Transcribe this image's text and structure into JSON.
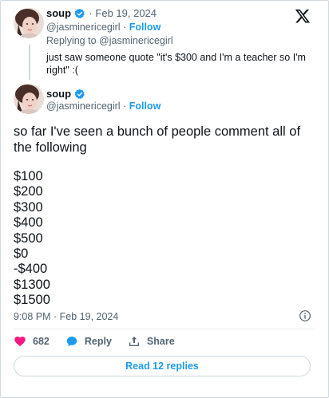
{
  "brand": {
    "logo": "x-logo-icon"
  },
  "parent_tweet": {
    "author_name": "soup",
    "verified_icon": "verified-badge-icon",
    "separator": "·",
    "date": "Feb 19, 2024",
    "handle": "@jasminericegirl",
    "follow_label": "Follow",
    "replying_to_prefix": "Replying to",
    "replying_to_handle": "@jasminericegirl",
    "text": "just saw someone quote \"it's $300 and I'm a teacher so I'm right\" :("
  },
  "main_tweet": {
    "author_name": "soup",
    "handle": "@jasminericegirl",
    "separator": "·",
    "follow_label": "Follow",
    "intro_text": "so far I've seen a bunch of people comment all of the following",
    "amounts": [
      "$100",
      "$200",
      "$300",
      "$400",
      "$500",
      "$0",
      "-$400",
      "$1300",
      "$1500"
    ],
    "timestamp": "9:08 PM · Feb 19, 2024",
    "info_icon": "info-icon"
  },
  "actions": {
    "like_count": "682",
    "reply_label": "Reply",
    "share_label": "Share"
  },
  "read_replies_label": "Read 12 replies",
  "colors": {
    "accent": "#1d9bf0",
    "like": "#f91880",
    "text": "#0f1419",
    "muted": "#536471",
    "border": "#cfd9de"
  }
}
